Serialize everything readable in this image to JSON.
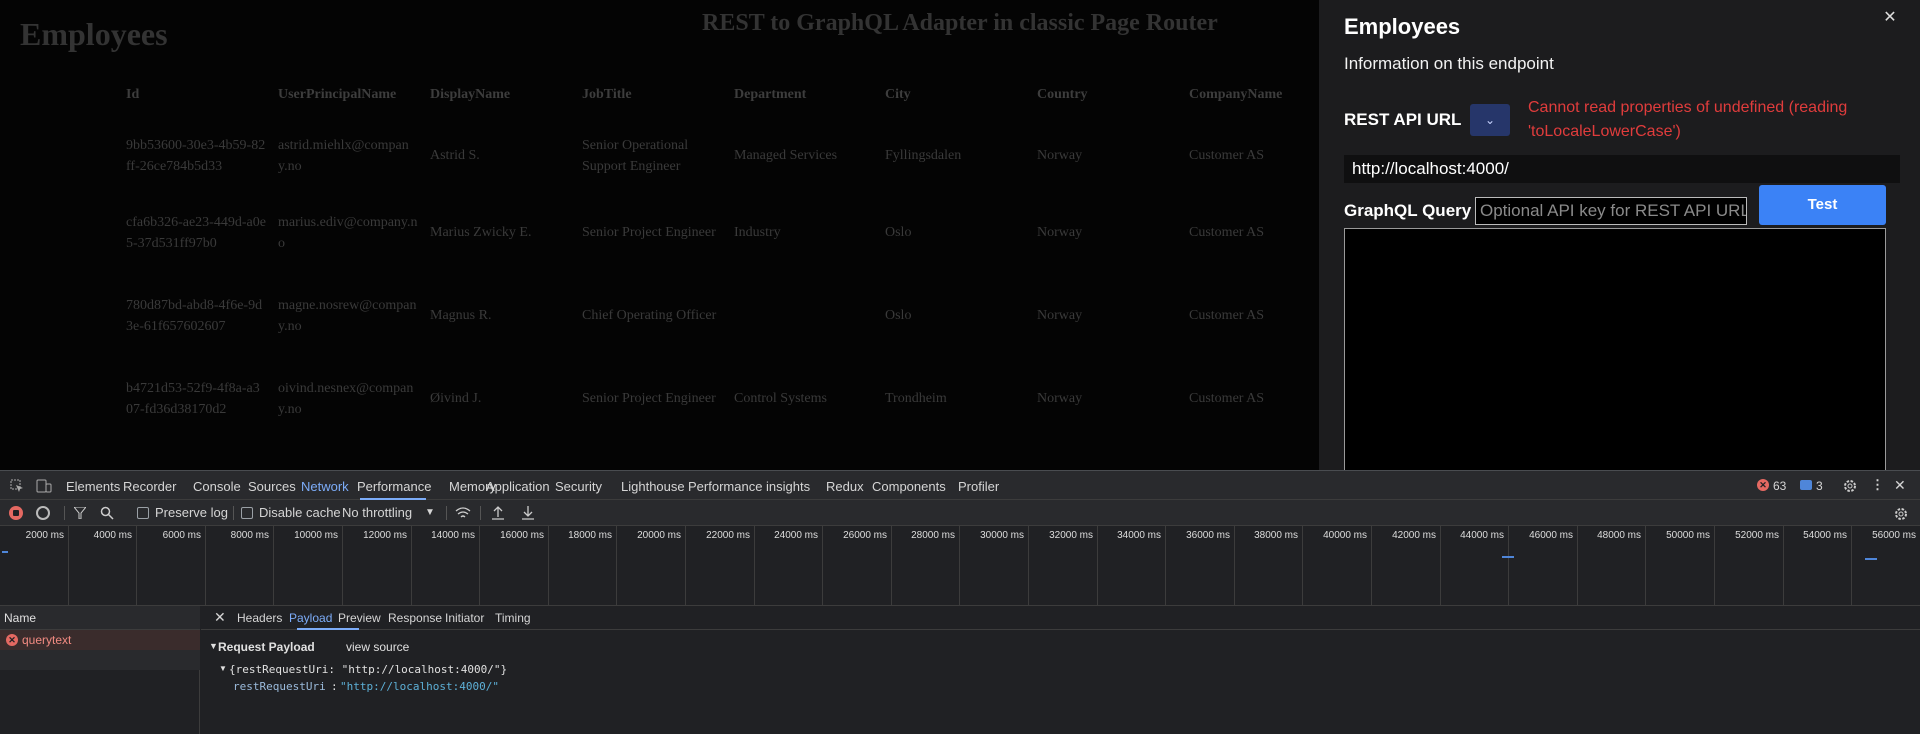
{
  "page": {
    "heading": "Employees",
    "subtitle": "REST to GraphQL Adapter in classic Page Router",
    "table": {
      "columns": [
        "Id",
        "UserPrincipalName",
        "DisplayName",
        "JobTitle",
        "Department",
        "City",
        "Country",
        "CompanyName"
      ],
      "rows": [
        [
          "9bb53600-30e3-4b59-82ff-26ce784b5d33",
          "astrid.miehlx@company.no",
          "Astrid S.",
          "Senior Operational Support Engineer",
          "Managed Services",
          "Fyllingsdalen",
          "Norway",
          "Customer AS"
        ],
        [
          "cfa6b326-ae23-449d-a0e5-37d531ff97b0",
          "marius.ediv@company.no",
          "Marius Zwicky E.",
          "Senior Project Engineer",
          "Industry",
          "Oslo",
          "Norway",
          "Customer AS"
        ],
        [
          "780d87bd-abd8-4f6e-9d3e-61f657602607",
          "magne.nosrew@company.no",
          "Magnus R.",
          "Chief Operating Officer",
          "",
          "Oslo",
          "Norway",
          "Customer AS"
        ],
        [
          "b4721d53-52f9-4f8a-a307-fd36d38170d2",
          "oivind.nesnex@company.no",
          "Øivind J.",
          "Senior Project Engineer",
          "Control Systems",
          "Trondheim",
          "Norway",
          "Customer AS"
        ]
      ]
    }
  },
  "panel": {
    "title": "Employees",
    "close_glyph": "✕",
    "info": "Information on this endpoint",
    "rest_label": "REST API URL",
    "dropdown_glyph": "⌄",
    "error": "Cannot read properties of undefined (reading 'toLocaleLowerCase')",
    "rest_url": "http://localhost:4000/",
    "graphql_label": "GraphQL Query",
    "api_key_placeholder": "Optional API key for REST API URL",
    "test_label": "Test",
    "colors": {
      "accent": "#3b82f6",
      "error": "#e03c3c"
    }
  },
  "devtools": {
    "tabs": [
      "Elements",
      "Recorder",
      "Console",
      "Sources",
      "Network",
      "Performance",
      "Memory",
      "Application",
      "Security",
      "Lighthouse",
      "Performance insights",
      "Redux",
      "Components",
      "Profiler"
    ],
    "active_tab": "Network",
    "error_count": "63",
    "message_count": "3",
    "toolbar": {
      "preserve_log": "Preserve log",
      "disable_cache": "Disable cache",
      "throttling": "No throttling"
    },
    "timeline_ticks": [
      "2000 ms",
      "4000 ms",
      "6000 ms",
      "8000 ms",
      "10000 ms",
      "12000 ms",
      "14000 ms",
      "16000 ms",
      "18000 ms",
      "20000 ms",
      "22000 ms",
      "24000 ms",
      "26000 ms",
      "28000 ms",
      "30000 ms",
      "32000 ms",
      "34000 ms",
      "36000 ms",
      "38000 ms",
      "40000 ms",
      "42000 ms",
      "44000 ms",
      "46000 ms",
      "48000 ms",
      "50000 ms",
      "52000 ms",
      "54000 ms",
      "56000 ms"
    ],
    "name_header": "Name",
    "request_name": "querytext",
    "detail_tabs": [
      "Headers",
      "Payload",
      "Preview",
      "Response",
      "Initiator",
      "Timing"
    ],
    "active_detail_tab": "Payload",
    "payload": {
      "section_title": "Request Payload",
      "view_source": "view source",
      "summary": "{restRequestUri: \"http://localhost:4000/\"}",
      "key": "restRequestUri",
      "value": "\"http://localhost:4000/\""
    }
  }
}
